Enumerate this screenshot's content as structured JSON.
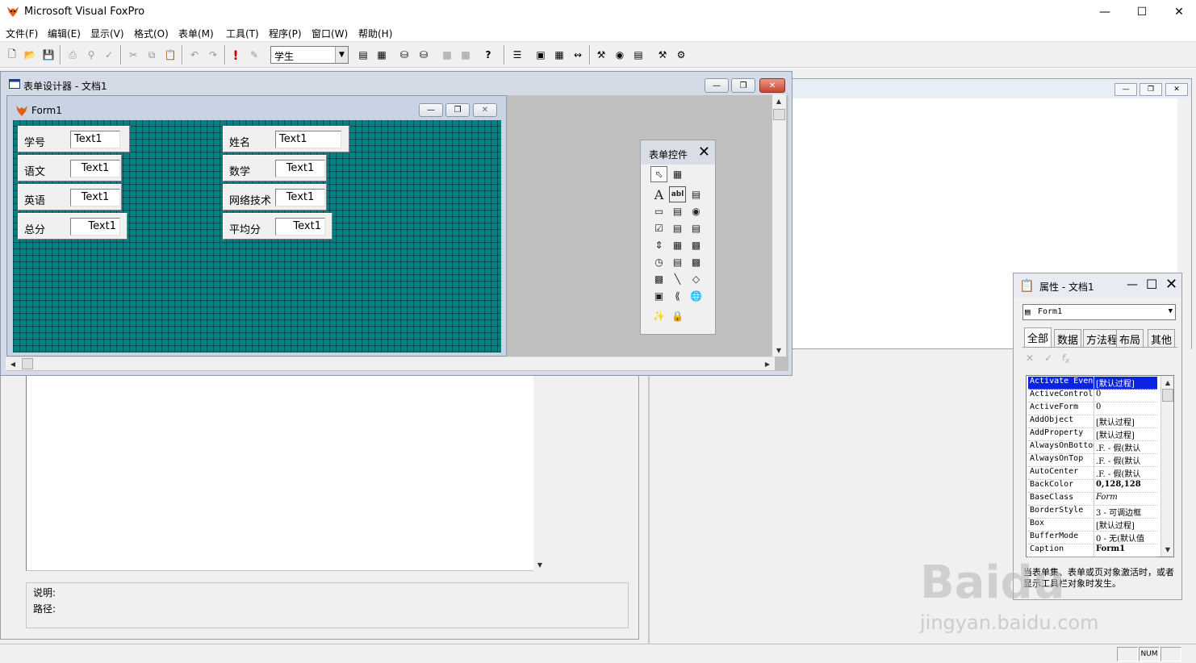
{
  "app": {
    "title": "Microsoft Visual FoxPro"
  },
  "menu": [
    "文件(F)",
    "编辑(E)",
    "显示(V)",
    "格式(O)",
    "表单(M)",
    "工具(T)",
    "程序(P)",
    "窗口(W)",
    "帮助(H)"
  ],
  "toolbar": {
    "combo_value": "学生"
  },
  "form_designer": {
    "title": "表单设计器 - 文档1",
    "form": {
      "title": "Form1",
      "fields": [
        {
          "label": "学号",
          "text": "Text1"
        },
        {
          "label": "语文",
          "text": "Text1"
        },
        {
          "label": "英语",
          "text": "Text1"
        },
        {
          "label": "总分",
          "text": "Text1"
        },
        {
          "label": "姓名",
          "text": "Text1"
        },
        {
          "label": "数学",
          "text": "Text1"
        },
        {
          "label": "网络技术",
          "text": "Text1"
        },
        {
          "label": "平均分",
          "text": "Text1"
        }
      ]
    }
  },
  "toolbox": {
    "title": "表单控件",
    "text_tool_glyph": "A",
    "textbox_glyph": "abl"
  },
  "left_pane": {
    "desc_label": "说明:",
    "path_label": "路径:"
  },
  "properties": {
    "title": "属性 - 文档1",
    "object": "Form1",
    "tabs": [
      "全部",
      "数据",
      "方法程",
      "布局",
      "其他"
    ],
    "rows": [
      {
        "name": "Activate Event",
        "value": "[默认过程]"
      },
      {
        "name": "ActiveControl",
        "value": "0"
      },
      {
        "name": "ActiveForm",
        "value": "0"
      },
      {
        "name": "AddObject",
        "value": "[默认过程]"
      },
      {
        "name": "AddProperty",
        "value": "[默认过程]"
      },
      {
        "name": "AlwaysOnBottom",
        "value": ".F. - 假(默认"
      },
      {
        "name": "AlwaysOnTop",
        "value": ".F. - 假(默认"
      },
      {
        "name": "AutoCenter",
        "value": ".F. - 假(默认"
      },
      {
        "name": "BackColor",
        "value": "0,128,128"
      },
      {
        "name": "BaseClass",
        "value": "Form"
      },
      {
        "name": "BorderStyle",
        "value": "3 - 可调边框"
      },
      {
        "name": "Box",
        "value": "[默认过程]"
      },
      {
        "name": "BufferMode",
        "value": "0 - 无(默认值"
      },
      {
        "name": "Caption",
        "value": "Form1"
      }
    ],
    "description": "当表单集、表单或页对象激活时，或者显示工具栏对象时发生。"
  },
  "statusbar": {
    "num": "NUM"
  },
  "watermark": {
    "logo": "Baidu",
    "site": "jingyan.baidu.com"
  },
  "colors": {
    "form_bg": "#008080",
    "selection": "#0a24e0"
  }
}
